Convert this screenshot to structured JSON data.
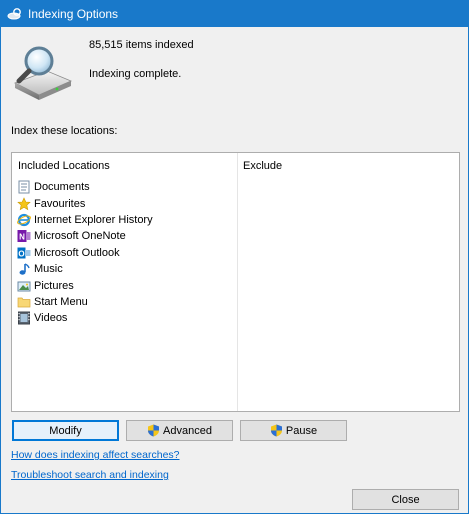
{
  "window": {
    "title": "Indexing Options",
    "title_bar_color": "#1979ca"
  },
  "summary": {
    "items_indexed": "85,515 items indexed",
    "status": "Indexing complete."
  },
  "locations": {
    "section_label": "Index these locations:",
    "included_header": "Included Locations",
    "exclude_header": "Exclude",
    "items": [
      {
        "label": "Documents",
        "icon": "documents-icon"
      },
      {
        "label": "Favourites",
        "icon": "star-icon"
      },
      {
        "label": "Internet Explorer History",
        "icon": "internet-explorer-icon"
      },
      {
        "label": "Microsoft OneNote",
        "icon": "onenote-icon"
      },
      {
        "label": "Microsoft Outlook",
        "icon": "outlook-icon"
      },
      {
        "label": "Music",
        "icon": "music-icon"
      },
      {
        "label": "Pictures",
        "icon": "pictures-icon"
      },
      {
        "label": "Start Menu",
        "icon": "folder-icon"
      },
      {
        "label": "Videos",
        "icon": "videos-icon"
      }
    ]
  },
  "buttons": {
    "modify": "Modify",
    "advanced": "Advanced",
    "pause": "Pause",
    "close": "Close"
  },
  "links": {
    "how_indexing": "How does indexing affect searches?",
    "troubleshoot": "Troubleshoot search and indexing"
  }
}
